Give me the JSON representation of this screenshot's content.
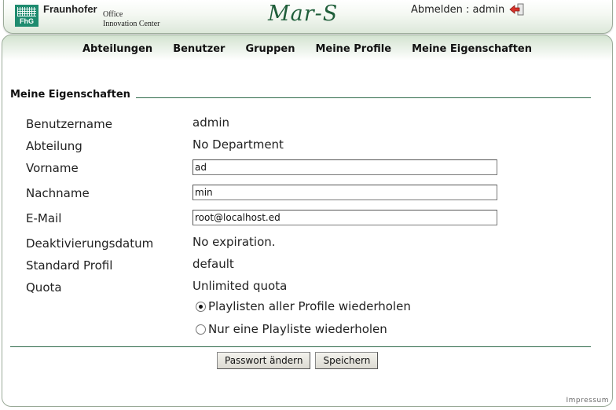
{
  "header": {
    "org_name": "Fraunhofer",
    "org_sub1": "Office",
    "org_sub2": "Innovation Center",
    "logo_text": "FhG",
    "app_title": "Mar-S",
    "logout_label": "Abmelden : admin",
    "logout_icon": "logout-arrow-icon",
    "brand_color": "#1e8b6f"
  },
  "nav": {
    "items": [
      "Abteilungen",
      "Benutzer",
      "Gruppen",
      "Meine Profile",
      "Meine Eigenschaften"
    ]
  },
  "section": {
    "title": "Meine Eigenschaften"
  },
  "fields": {
    "username": {
      "label": "Benutzername",
      "value": "admin"
    },
    "department": {
      "label": "Abteilung",
      "value": "No Department"
    },
    "firstname": {
      "label": "Vorname",
      "value": "ad"
    },
    "lastname": {
      "label": "Nachname",
      "value": "min"
    },
    "email": {
      "label": "E-Mail",
      "value": "root@localhost.ed"
    },
    "deactivation": {
      "label": "Deaktivierungsdatum",
      "value": "No expiration."
    },
    "default_profile": {
      "label": "Standard Profil",
      "value": "default"
    },
    "quota": {
      "label": "Quota",
      "value": "Unlimited quota"
    }
  },
  "playlist_options": [
    {
      "label": "Playlisten aller Profile wiederholen",
      "selected": true
    },
    {
      "label": "Nur eine Playliste wiederholen",
      "selected": false
    }
  ],
  "buttons": {
    "change_password": "Passwort ändern",
    "save": "Speichern"
  },
  "footer": {
    "impressum": "Impressum"
  },
  "colors": {
    "accent_line": "#2f6a4a",
    "title_color": "#1f5e3a"
  }
}
